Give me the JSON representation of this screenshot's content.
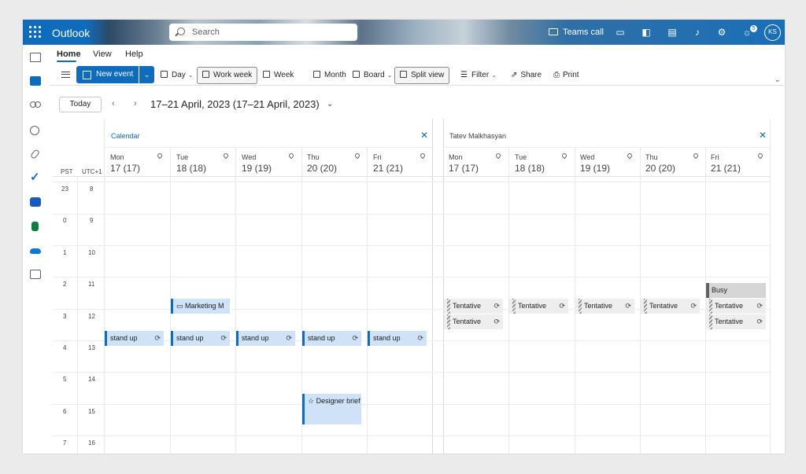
{
  "header": {
    "app_name": "Outlook",
    "search_placeholder": "Search",
    "teams_call": "Teams call",
    "avatar_initials": "KS",
    "notification_count": "5"
  },
  "ribbon": {
    "tabs": [
      "Home",
      "View",
      "Help"
    ],
    "new_event": "New event",
    "day": "Day",
    "work_week": "Work week",
    "week": "Week",
    "month": "Month",
    "board": "Board",
    "split_view": "Split view",
    "filter": "Filter",
    "share": "Share",
    "print": "Print"
  },
  "nav": {
    "today": "Today",
    "date_range": "17–21 April, 2023  (17–21 April, 2023)"
  },
  "timezones": [
    "PST",
    "UTC+1"
  ],
  "hours_pst": [
    "23",
    "0",
    "1",
    "2",
    "3",
    "4",
    "5",
    "6",
    "7"
  ],
  "hours_utc": [
    "8",
    "9",
    "10",
    "11",
    "12",
    "13",
    "14",
    "15",
    "16"
  ],
  "panes": [
    {
      "title": "Calendar",
      "days": [
        {
          "name": "Mon",
          "num": "17 (17)"
        },
        {
          "name": "Tue",
          "num": "18 (18)"
        },
        {
          "name": "Wed",
          "num": "19 (19)"
        },
        {
          "name": "Thu",
          "num": "20 (20)"
        },
        {
          "name": "Fri",
          "num": "21 (21)"
        }
      ],
      "events": {
        "marketing": "Marketing M",
        "standup": "stand up",
        "designer": "Designer brief"
      }
    },
    {
      "title": "Tatev Malkhasyan",
      "days": [
        {
          "name": "Mon",
          "num": "17 (17)"
        },
        {
          "name": "Tue",
          "num": "18 (18)"
        },
        {
          "name": "Wed",
          "num": "19 (19)"
        },
        {
          "name": "Thu",
          "num": "20 (20)"
        },
        {
          "name": "Fri",
          "num": "21 (21)"
        }
      ],
      "events": {
        "tentative": "Tentative",
        "busy": "Busy"
      }
    }
  ],
  "colors": {
    "accent": "#0f6cbd",
    "event_fill": "#cfe2f7"
  }
}
